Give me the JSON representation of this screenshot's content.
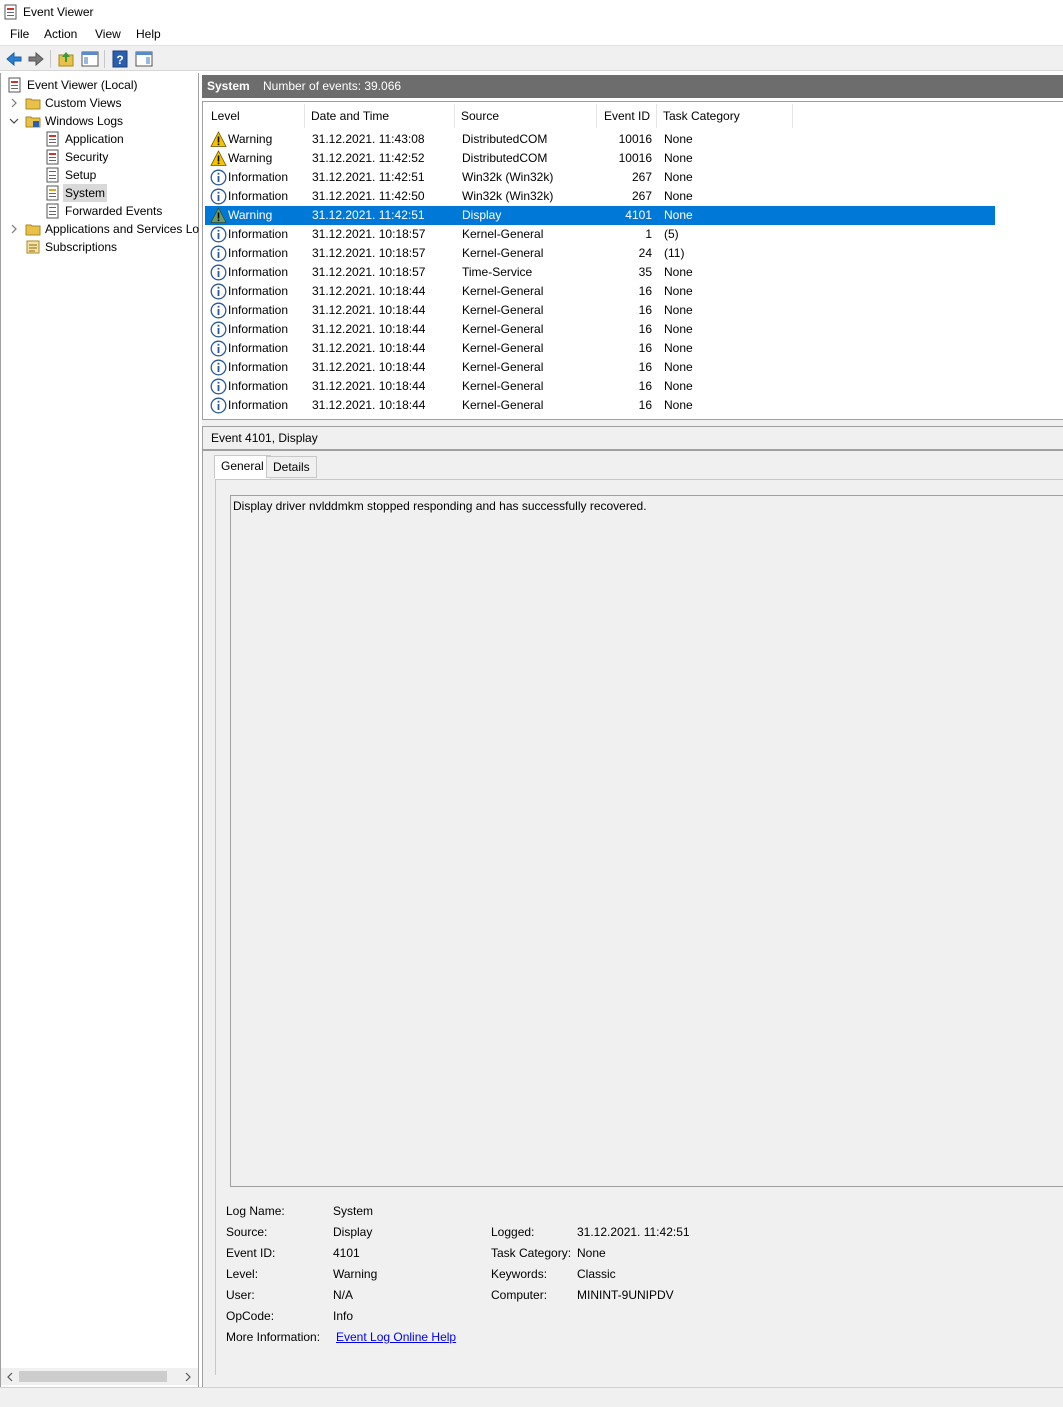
{
  "window": {
    "title": "Event Viewer"
  },
  "menu": {
    "file": "File",
    "action": "Action",
    "view": "View",
    "help": "Help"
  },
  "toolbar": {
    "back_icon": "back-arrow-icon",
    "forward_icon": "forward-arrow-icon",
    "up_icon": "up-folder-icon",
    "show_hide_tree_icon": "console-tree-icon",
    "help_icon": "help-icon",
    "action_pane_icon": "action-pane-icon"
  },
  "tree": {
    "root": "Event Viewer (Local)",
    "custom_views": "Custom Views",
    "windows_logs": "Windows Logs",
    "application": "Application",
    "security": "Security",
    "setup": "Setup",
    "system": "System",
    "forwarded_events": "Forwarded Events",
    "app_services_logs": "Applications and Services Lo",
    "subscriptions": "Subscriptions"
  },
  "log_header": {
    "name": "System",
    "count_text": "Number of events: 39.066"
  },
  "columns": {
    "level": "Level",
    "date_time": "Date and Time",
    "source": "Source",
    "event_id": "Event ID",
    "task_category": "Task Category"
  },
  "events": [
    {
      "level": "Warning",
      "datetime": "31.12.2021. 11:43:08",
      "source": "DistributedCOM",
      "event_id": "10016",
      "task_category": "None"
    },
    {
      "level": "Warning",
      "datetime": "31.12.2021. 11:42:52",
      "source": "DistributedCOM",
      "event_id": "10016",
      "task_category": "None"
    },
    {
      "level": "Information",
      "datetime": "31.12.2021. 11:42:51",
      "source": "Win32k (Win32k)",
      "event_id": "267",
      "task_category": "None"
    },
    {
      "level": "Information",
      "datetime": "31.12.2021. 11:42:50",
      "source": "Win32k (Win32k)",
      "event_id": "267",
      "task_category": "None"
    },
    {
      "level": "Warning",
      "datetime": "31.12.2021. 11:42:51",
      "source": "Display",
      "event_id": "4101",
      "task_category": "None"
    },
    {
      "level": "Information",
      "datetime": "31.12.2021. 10:18:57",
      "source": "Kernel-General",
      "event_id": "1",
      "task_category": "(5)"
    },
    {
      "level": "Information",
      "datetime": "31.12.2021. 10:18:57",
      "source": "Kernel-General",
      "event_id": "24",
      "task_category": "(11)"
    },
    {
      "level": "Information",
      "datetime": "31.12.2021. 10:18:57",
      "source": "Time-Service",
      "event_id": "35",
      "task_category": "None"
    },
    {
      "level": "Information",
      "datetime": "31.12.2021. 10:18:44",
      "source": "Kernel-General",
      "event_id": "16",
      "task_category": "None"
    },
    {
      "level": "Information",
      "datetime": "31.12.2021. 10:18:44",
      "source": "Kernel-General",
      "event_id": "16",
      "task_category": "None"
    },
    {
      "level": "Information",
      "datetime": "31.12.2021. 10:18:44",
      "source": "Kernel-General",
      "event_id": "16",
      "task_category": "None"
    },
    {
      "level": "Information",
      "datetime": "31.12.2021. 10:18:44",
      "source": "Kernel-General",
      "event_id": "16",
      "task_category": "None"
    },
    {
      "level": "Information",
      "datetime": "31.12.2021. 10:18:44",
      "source": "Kernel-General",
      "event_id": "16",
      "task_category": "None"
    },
    {
      "level": "Information",
      "datetime": "31.12.2021. 10:18:44",
      "source": "Kernel-General",
      "event_id": "16",
      "task_category": "None"
    },
    {
      "level": "Information",
      "datetime": "31.12.2021. 10:18:44",
      "source": "Kernel-General",
      "event_id": "16",
      "task_category": "None"
    }
  ],
  "selected_event_index": 4,
  "detail": {
    "title": "Event 4101, Display",
    "tabs": {
      "general": "General",
      "details": "Details"
    },
    "description": "Display driver nvlddmkm stopped responding and has successfully recovered.",
    "labels": {
      "log_name": "Log Name:",
      "source": "Source:",
      "event_id": "Event ID:",
      "level": "Level:",
      "user": "User:",
      "opcode": "OpCode:",
      "more_info": "More Information:",
      "logged": "Logged:",
      "task_category": "Task Category:",
      "keywords": "Keywords:",
      "computer": "Computer:"
    },
    "values": {
      "log_name": "System",
      "source": "Display",
      "event_id": "4101",
      "level": "Warning",
      "user": "N/A",
      "opcode": "Info",
      "more_info_link": "Event Log Online Help",
      "logged": "31.12.2021. 11:42:51",
      "task_category": "None",
      "keywords": "Classic",
      "computer": "MININT-9UNIPDV"
    }
  },
  "colors": {
    "selection": "#0078d7",
    "header_strip": "#6d6d6d",
    "warning": "#f5c400",
    "info": "#2b5797"
  }
}
